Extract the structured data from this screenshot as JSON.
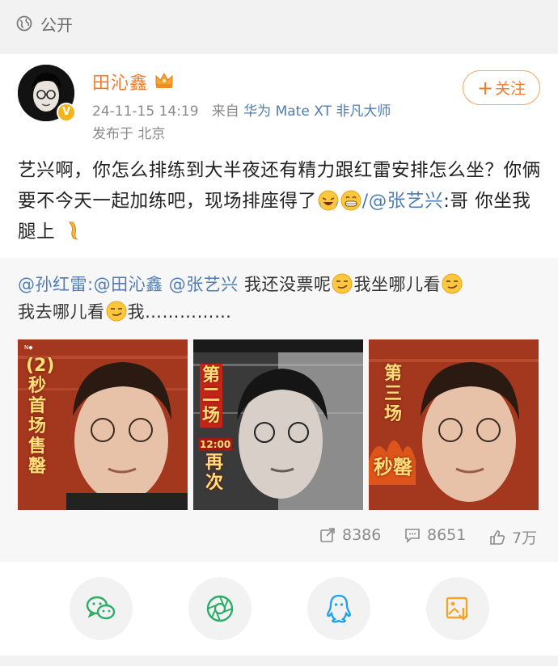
{
  "visibility": {
    "label": "公开",
    "icon": "globe-icon"
  },
  "post": {
    "author": {
      "name": "田沁鑫",
      "badge": "V",
      "crown_icon": "crown-icon"
    },
    "follow_button": {
      "plus": "+",
      "label": "关注"
    },
    "time": "24-11-15 14:19",
    "from_label": "来自",
    "device": "华为 Mate XT 非凡大师",
    "location": "发布于 北京",
    "content": {
      "line1": "艺兴啊，你怎么排练到大半夜还有精力跟红雷安排怎么坐？你俩要不今天一起加练吧，现场排座得了",
      "slash_at": "/@",
      "mention1": "张艺兴",
      "line_end": ":哥 你坐我腿上"
    }
  },
  "repost": {
    "mention_author": "@孙红雷",
    "mention_a": ":@田沁鑫",
    "mention_b": "@张艺兴",
    "text1": " 我还没票呢",
    "text2": "我坐哪儿看",
    "text3": "我去哪儿看",
    "text4": "我……………",
    "photos": [
      {
        "overlay": [
          "(2)",
          "秒",
          "首",
          "场",
          "售",
          "罄"
        ]
      },
      {
        "overlay_top": [
          "第",
          "二",
          "场"
        ],
        "time": "12:00",
        "overlay_bottom": [
          "再",
          "次"
        ]
      },
      {
        "overlay_top": [
          "第",
          "三",
          "场"
        ],
        "overlay_bottom": [
          "秒",
          "罄"
        ]
      }
    ],
    "stats": {
      "repost_count": "8386",
      "comment_count": "8651",
      "like_count": "7万"
    }
  },
  "share": {
    "items": [
      "wechat-icon",
      "moments-icon",
      "qq-icon",
      "save-image-icon"
    ]
  },
  "colors": {
    "accent": "#f07a2c",
    "link": "#4f7cb3",
    "wechat": "#2aae67",
    "qq": "#1ea0e8",
    "save": "#f3a52b"
  }
}
